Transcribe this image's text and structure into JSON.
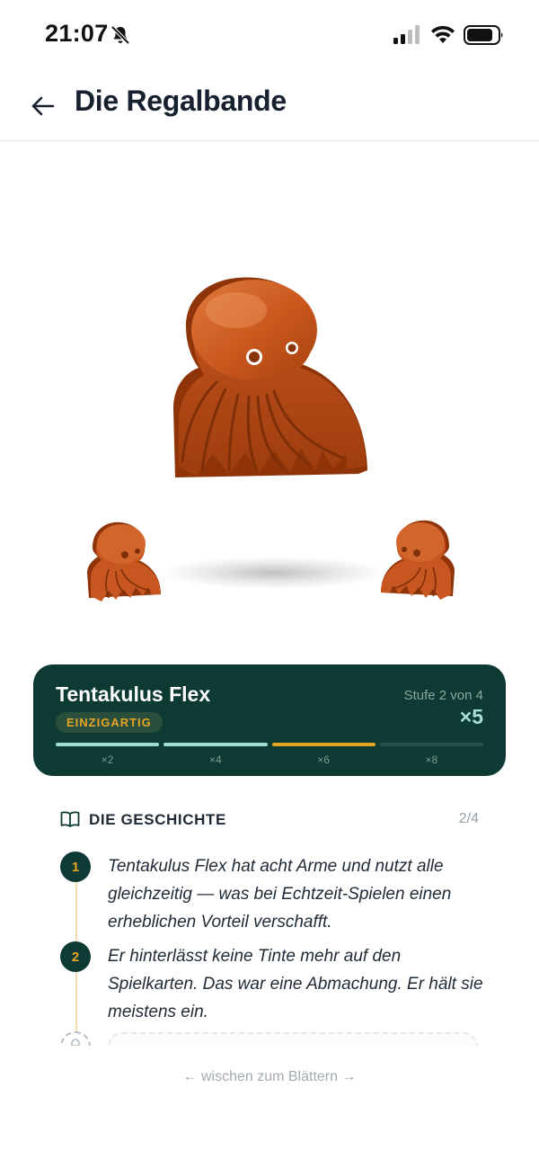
{
  "status_bar": {
    "time": "21:07",
    "icons": [
      "bell-off-icon",
      "signal-icon",
      "wifi-icon",
      "battery-icon"
    ]
  },
  "header": {
    "back_icon": "arrow-left-icon",
    "title": "Die Regalbande"
  },
  "hero": {
    "main_figure": "octopus-figure",
    "side_figures": [
      "octopus-figure-small",
      "octopus-figure-small"
    ],
    "figure_color": "#c9571c"
  },
  "card": {
    "name": "Tentakulus Flex",
    "rarity": "EINZIGARTIG",
    "level": "Stufe 2 von 4",
    "multiplier": "×5",
    "progress": [
      {
        "label": "×2",
        "color": "#9fdcd2",
        "filled": true
      },
      {
        "label": "×4",
        "color": "#9fdcd2",
        "filled": true
      },
      {
        "label": "×6",
        "color": "#e2a523",
        "filled": true
      },
      {
        "label": "×8",
        "color": "#24514a",
        "filled": false
      }
    ],
    "colors": {
      "background": "#0d3b33",
      "accent": "#e6a325"
    }
  },
  "story": {
    "icon": "book-icon",
    "title": "DIE GESCHICHTE",
    "page": "2/4",
    "entries": [
      {
        "number": "1",
        "text": "Tentakulus Flex hat acht Arme und nutzt alle gleichzeitig — was bei Echtzeit-Spielen einen erheblichen Vorteil verschafft."
      },
      {
        "number": "2",
        "text": "Er hinterlässt keine Tinte mehr auf den Spielkarten. Das war eine Abmachung. Er hält sie meistens ein."
      }
    ],
    "locked_icon": "lock-icon"
  },
  "swipe_hint": "← wischen zum Blättern →"
}
